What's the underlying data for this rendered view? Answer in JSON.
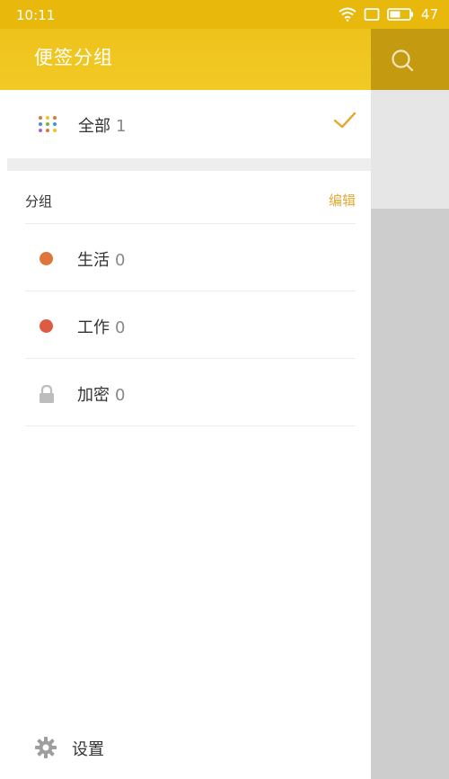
{
  "status_bar": {
    "time": "10:11",
    "battery": "47"
  },
  "drawer": {
    "title": "便签分组",
    "all": {
      "label": "全部",
      "count": "1"
    },
    "section_title": "分组",
    "edit_label": "编辑",
    "groups": [
      {
        "label": "生活",
        "count": "0",
        "color": "#e0753b"
      },
      {
        "label": "工作",
        "count": "0",
        "color": "#de5a43"
      },
      {
        "label": "加密",
        "count": "0"
      }
    ],
    "settings_label": "设置"
  },
  "colors": {
    "accent": "#f0c41f",
    "edit": "#e3a93a"
  }
}
